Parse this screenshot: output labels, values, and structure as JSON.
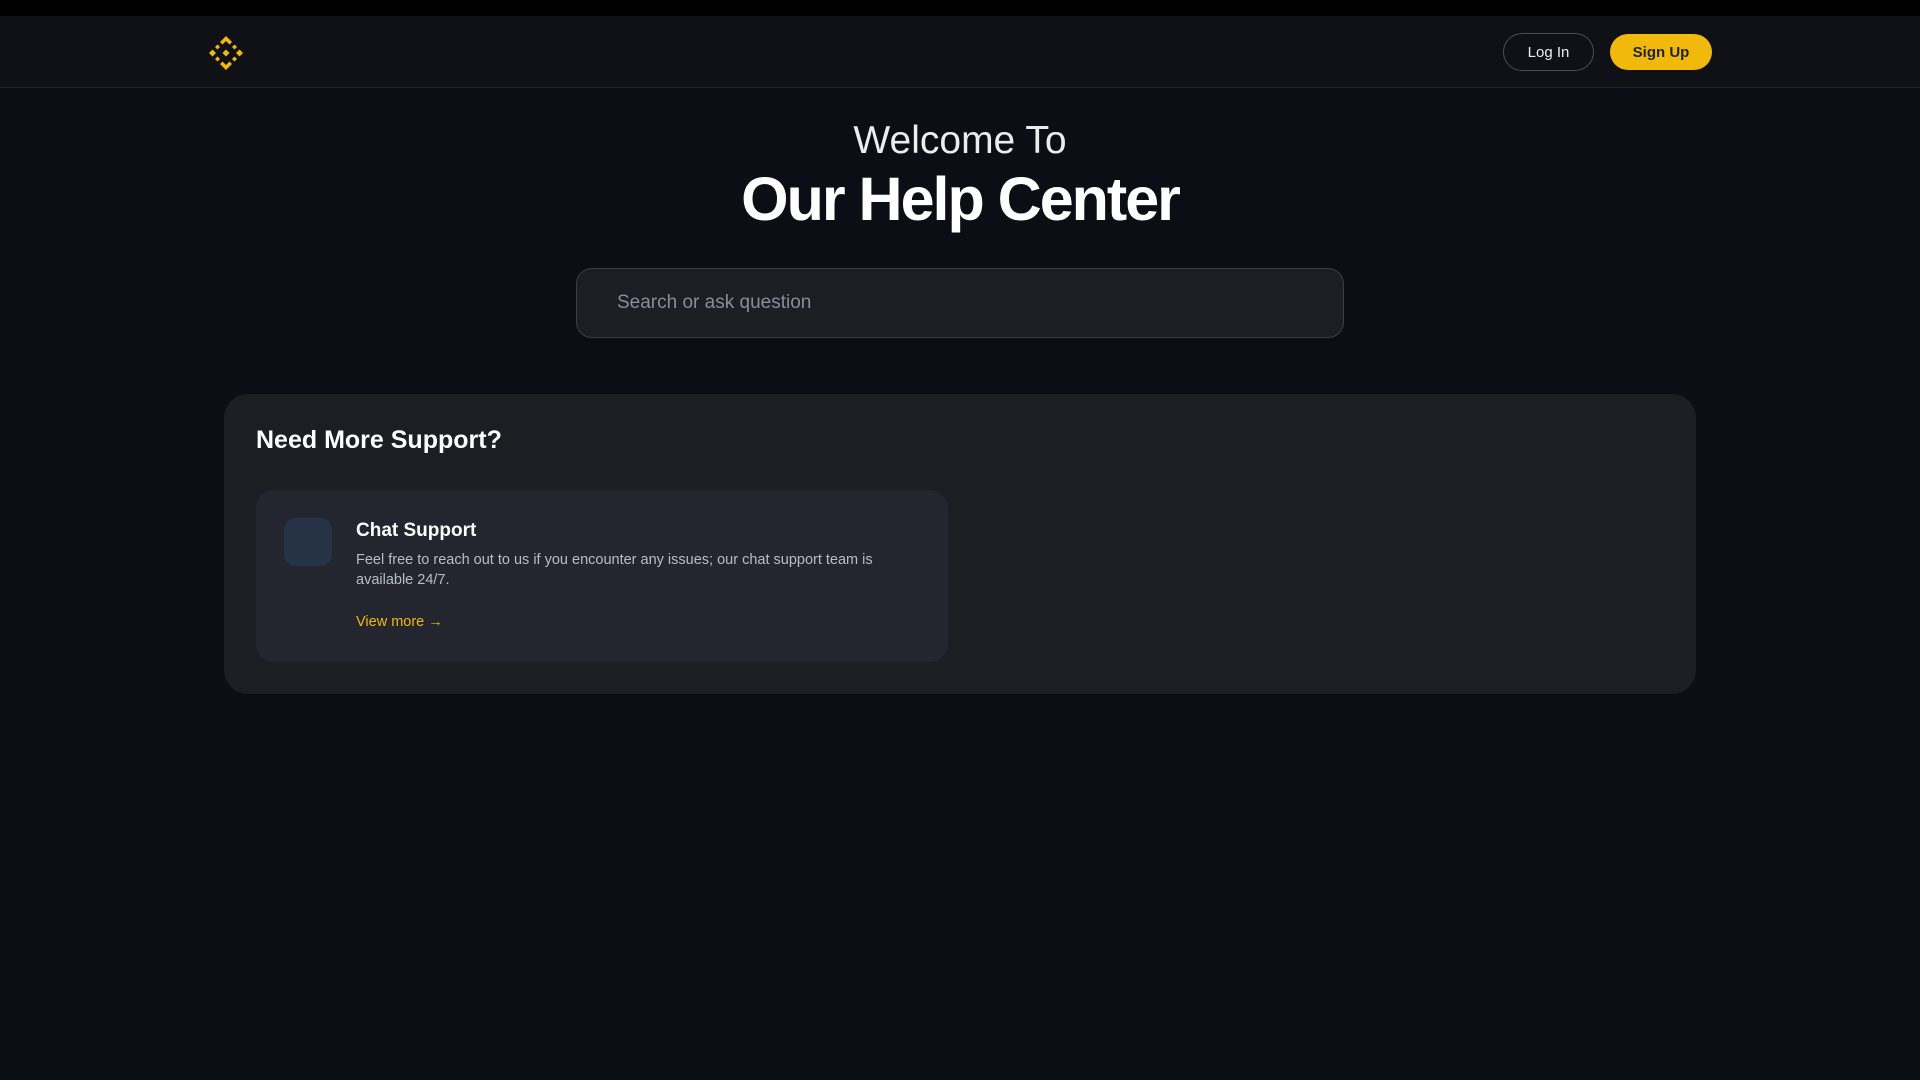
{
  "header": {
    "logo_icon": "binance-logo-icon",
    "login_label": "Log In",
    "signup_label": "Sign Up"
  },
  "hero": {
    "welcome": "Welcome To",
    "title": "Our Help Center"
  },
  "search": {
    "placeholder": "Search or ask question"
  },
  "support": {
    "title": "Need More Support?",
    "cards": [
      {
        "icon": "chat-icon",
        "title": "Chat Support",
        "description": "Feel free to reach out to us if you encounter any issues; our chat support team is available 24/7.",
        "link": "View more →"
      }
    ]
  },
  "colors": {
    "accent": "#f0b90b",
    "background": "#0b0e14",
    "panel": "#1c1e23",
    "card": "#23262e"
  }
}
